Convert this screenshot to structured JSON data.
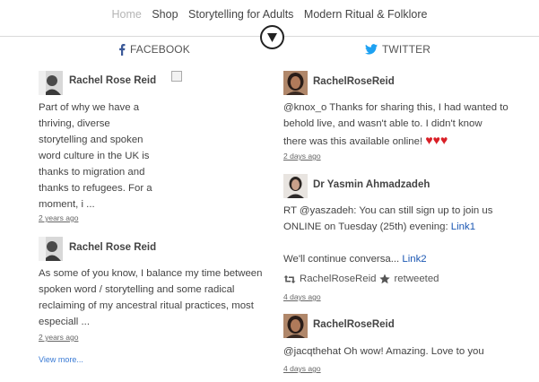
{
  "nav": {
    "items": [
      {
        "label": "Home",
        "active": true
      },
      {
        "label": "Shop",
        "active": false
      },
      {
        "label": "Storytelling for Adults",
        "active": false
      },
      {
        "label": "Modern Ritual & Folklore",
        "active": false
      }
    ],
    "toggle_icon": "circle-down-arrow-icon"
  },
  "facebook": {
    "heading": "FACEBOOK",
    "posts": [
      {
        "author": "Rachel Rose Reid",
        "lines": [
          "Part of why we have a",
          "thriving, diverse",
          "storytelling and spoken",
          "word culture in the UK is",
          "thanks to migration and",
          "thanks to refugees. For a",
          "moment, i ..."
        ],
        "time": "2 years ago"
      },
      {
        "author": "Rachel Rose Reid",
        "lines": [
          "As some of you know, I balance my time between",
          "spoken word / storytelling and some radical",
          "reclaiming of my ancestral ritual practices, most",
          "especiall ..."
        ],
        "time": "2 years ago"
      }
    ],
    "view_more": "View more..."
  },
  "twitter": {
    "heading": "TWITTER",
    "posts": [
      {
        "author": "RachelRoseReid",
        "lines": [
          "@knox_o Thanks for sharing this, I had wanted to",
          "behold live, and wasn't able to. I didn't know",
          "there was this available online!"
        ],
        "hearts": "♥♥♥",
        "time": "2 days ago"
      },
      {
        "author": "Dr Yasmin Ahmadzadeh",
        "line1": "RT @yaszadeh: You can still sign up to join us",
        "line2_text": "ONLINE on Tuesday (25th) evening: ",
        "line2_link": "Link1",
        "line3_text": "We'll continue conversa... ",
        "line3_link": "Link2",
        "retweet_by": "RachelRoseReid",
        "retweet_label": "retweeted",
        "time": "4 days ago"
      },
      {
        "author": "RachelRoseReid",
        "lines": [
          "@jacqthehat Oh wow! Amazing. Love to you"
        ],
        "time": "4 days ago"
      }
    ]
  },
  "colors": {
    "link": "#1b57b3",
    "heart": "#d91f26",
    "facebook": "#3b5998",
    "twitter": "#1da1f2"
  }
}
